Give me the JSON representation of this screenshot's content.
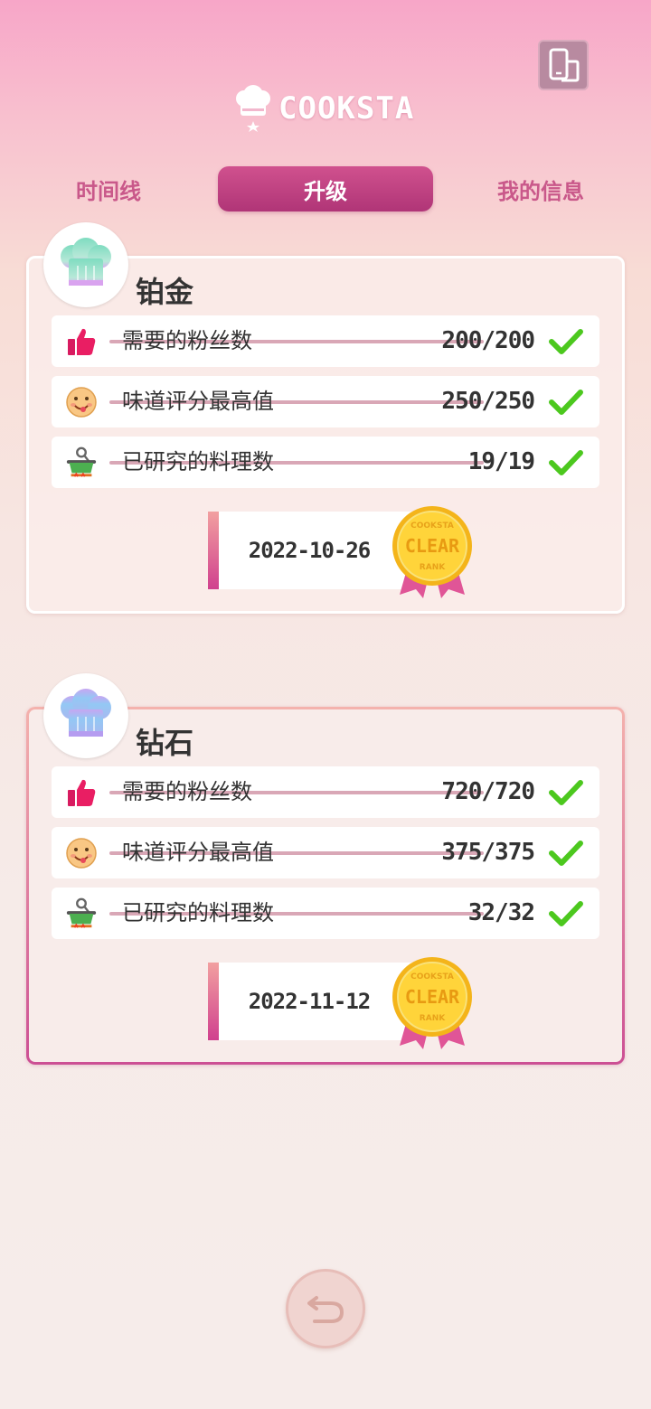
{
  "header": {
    "brand": "COOKSTA"
  },
  "tabs": [
    {
      "label": "时间线",
      "active": false
    },
    {
      "label": "升级",
      "active": true
    },
    {
      "label": "我的信息",
      "active": false
    }
  ],
  "ranks": [
    {
      "name": "铂金",
      "hat_color": "#8ee0c4",
      "requirements": [
        {
          "icon": "thumbs-up-icon",
          "label": "需要的粉丝数",
          "value": "200/200",
          "done": true
        },
        {
          "icon": "taste-face-icon",
          "label": "味道评分最高值",
          "value": "250/250",
          "done": true
        },
        {
          "icon": "cooking-pot-icon",
          "label": "已研究的料理数",
          "value": "19/19",
          "done": true
        }
      ],
      "cleared_date": "2022-10-26",
      "medal_text": {
        "top": "COOKSTA",
        "main": "CLEAR",
        "bottom": "RANK"
      }
    },
    {
      "name": "钻石",
      "hat_color": "#9cc0ee",
      "requirements": [
        {
          "icon": "thumbs-up-icon",
          "label": "需要的粉丝数",
          "value": "720/720",
          "done": true
        },
        {
          "icon": "taste-face-icon",
          "label": "味道评分最高值",
          "value": "375/375",
          "done": true
        },
        {
          "icon": "cooking-pot-icon",
          "label": "已研究的料理数",
          "value": "32/32",
          "done": true
        }
      ],
      "cleared_date": "2022-11-12",
      "medal_text": {
        "top": "COOKSTA",
        "main": "CLEAR",
        "bottom": "RANK"
      }
    }
  ],
  "colors": {
    "accent": "#c03c80",
    "check": "#4cc81e",
    "tab_text": "#c9588a"
  }
}
